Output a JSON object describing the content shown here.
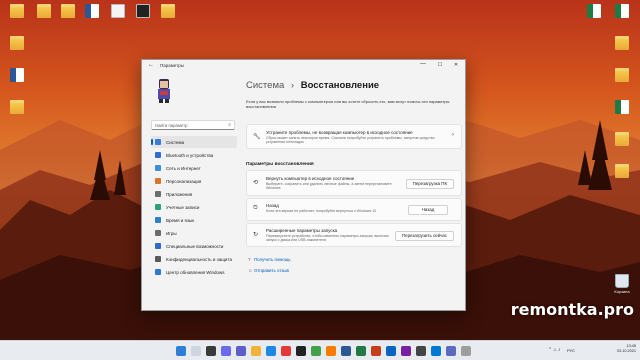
{
  "window": {
    "title": "Параметры",
    "back_glyph": "←",
    "minimize_glyph": "—",
    "maximize_glyph": "☐",
    "close_glyph": "✕"
  },
  "sidebar": {
    "search_placeholder": "Найти параметр",
    "search_icon": "search-icon",
    "items": [
      {
        "label": "Система",
        "icon": "system-icon",
        "color": "#3a7bd5",
        "active": true
      },
      {
        "label": "Bluetooth и устройства",
        "icon": "bluetooth-icon",
        "color": "#2f6fd0",
        "active": false
      },
      {
        "label": "Сеть и Интернет",
        "icon": "network-icon",
        "color": "#3b8fd8",
        "active": false
      },
      {
        "label": "Персонализация",
        "icon": "brush-icon",
        "color": "#d9762b",
        "active": false
      },
      {
        "label": "Приложения",
        "icon": "apps-icon",
        "color": "#6d6d6d",
        "active": false
      },
      {
        "label": "Учетные записи",
        "icon": "accounts-icon",
        "color": "#2aa07a",
        "active": false
      },
      {
        "label": "Время и язык",
        "icon": "time-language-icon",
        "color": "#2f7fc9",
        "active": false
      },
      {
        "label": "Игры",
        "icon": "gaming-icon",
        "color": "#6b6b6b",
        "active": false
      },
      {
        "label": "Специальные возможности",
        "icon": "accessibility-icon",
        "color": "#2e6cc4",
        "active": false
      },
      {
        "label": "Конфиденциальность и защита",
        "icon": "shield-icon",
        "color": "#5a5a5a",
        "active": false
      },
      {
        "label": "Центр обновления Windows",
        "icon": "update-icon",
        "color": "#2f78d0",
        "active": false
      }
    ]
  },
  "main": {
    "breadcrumb_parent": "Система",
    "breadcrumb_sep": "›",
    "breadcrumb_current": "Восстановление",
    "intro": "Если у вас возникли проблемы с компьютером или вы хотите сбросить его, вам могут помочь эти параметры восстановления",
    "troubleshoot": {
      "title": "Устраните проблемы, не возвращая компьютер в исходное состояние",
      "desc": "Сброс может занять некоторое время. Сначала попробуйте устранить проблемы, запустив средство устранения неполадок",
      "icon": "wrench-icon",
      "chevron": "›"
    },
    "section_title": "Параметры восстановления",
    "options": [
      {
        "title": "Вернуть компьютер в исходное состояние",
        "desc": "Выберите, сохранить или удалить личные файлы, а затем переустановите Windows",
        "button": "Перезагрузка ПК",
        "icon": "reset-pc-icon"
      },
      {
        "title": "Назад",
        "desc": "Если эта версия не работает, попробуйте вернуться к Windows 10",
        "button": "Назад",
        "icon": "history-icon"
      },
      {
        "title": "Расширенные параметры запуска",
        "desc": "Перезапустите устройство, чтобы изменить параметры запуска, включая запуск с диска или USB-накопителя",
        "button": "Перезагрузить сейчас",
        "icon": "advanced-startup-icon"
      }
    ],
    "links": [
      {
        "label": "Получить помощь",
        "icon": "help-icon"
      },
      {
        "label": "Отправить отзыв",
        "icon": "feedback-icon"
      }
    ]
  },
  "desktop": {
    "watermark": "remontka.pro",
    "recycle_bin": "Корзина"
  },
  "taskbar": {
    "lang": "РУС",
    "time": "13:45",
    "date": "03.10.2021"
  }
}
